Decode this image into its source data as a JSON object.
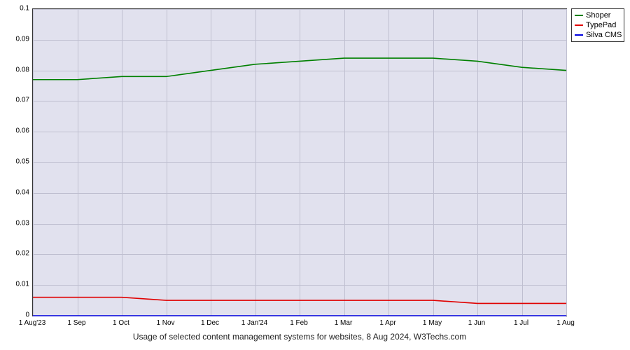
{
  "chart_data": {
    "type": "line",
    "title": "Usage of selected content management systems for websites, 8 Aug 2024, W3Techs.com",
    "xlabel": "",
    "ylabel": "",
    "ylim": [
      0,
      0.1
    ],
    "y_ticks": [
      0,
      0.01,
      0.02,
      0.03,
      0.04,
      0.05,
      0.06,
      0.07,
      0.08,
      0.09,
      0.1
    ],
    "categories": [
      "1 Aug'23",
      "1 Sep",
      "1 Oct",
      "1 Nov",
      "1 Dec",
      "1 Jan'24",
      "1 Feb",
      "1 Mar",
      "1 Apr",
      "1 May",
      "1 Jun",
      "1 Jul",
      "1 Aug"
    ],
    "series": [
      {
        "name": "Shoper",
        "color": "#008000",
        "values": [
          0.077,
          0.077,
          0.078,
          0.078,
          0.08,
          0.082,
          0.083,
          0.084,
          0.084,
          0.084,
          0.083,
          0.081,
          0.08
        ]
      },
      {
        "name": "TypePad",
        "color": "#e00000",
        "values": [
          0.006,
          0.006,
          0.006,
          0.005,
          0.005,
          0.005,
          0.005,
          0.005,
          0.005,
          0.005,
          0.004,
          0.004,
          0.004
        ]
      },
      {
        "name": "Silva CMS",
        "color": "#0000e0",
        "values": [
          0.0,
          0.0,
          0.0,
          0.0,
          0.0,
          0.0,
          0.0,
          0.0,
          0.0,
          0.0,
          0.0,
          0.0,
          0.0
        ]
      }
    ],
    "legend_position": "right"
  }
}
